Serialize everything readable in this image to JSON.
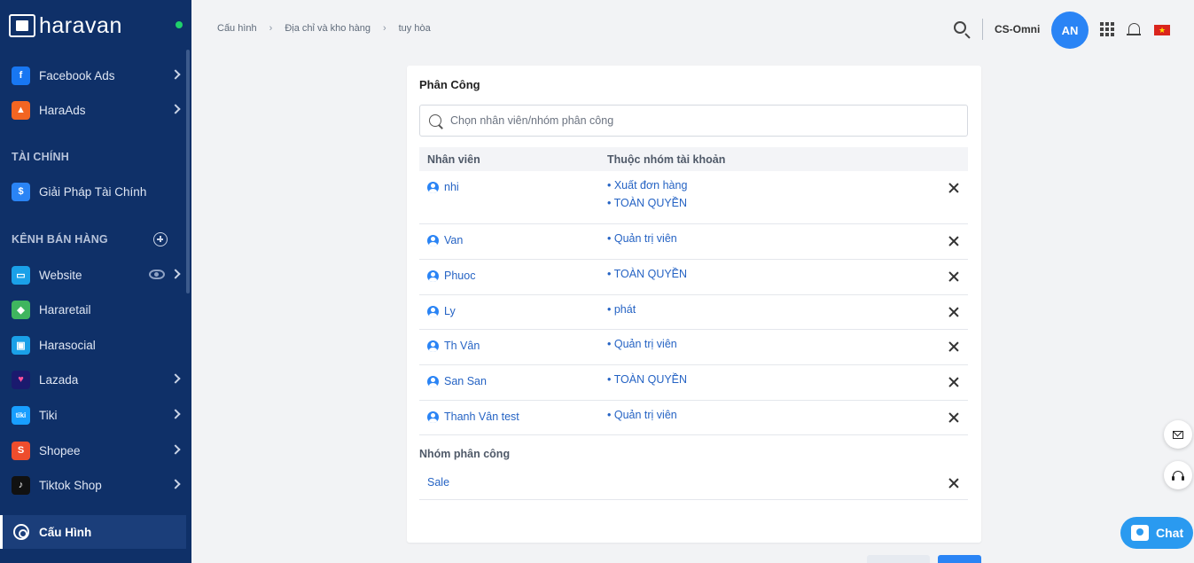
{
  "brand": {
    "logo_text": "haravan"
  },
  "sidebar": {
    "items_top": [
      {
        "label": "Facebook Ads",
        "icon": "facebook-icon",
        "color": "#1877f2",
        "glyph": "f"
      },
      {
        "label": "HaraAds",
        "icon": "haraads-icon",
        "color": "#f26522",
        "glyph": "▲"
      }
    ],
    "section_finance": "TÀI CHÍNH",
    "finance_item": {
      "label": "Giải Pháp Tài Chính",
      "icon": "finance-icon",
      "color": "#2a84f5",
      "glyph": "$"
    },
    "section_channels": "KÊNH BÁN HÀNG",
    "channels": [
      {
        "label": "Website",
        "icon": "website-icon",
        "color": "#1aa0e8",
        "glyph": "▭"
      },
      {
        "label": "Hararetail",
        "icon": "hararetail-icon",
        "color": "#3fb55f",
        "glyph": "◆"
      },
      {
        "label": "Harasocial",
        "icon": "harasocial-icon",
        "color": "#1aa0e8",
        "glyph": "▣"
      },
      {
        "label": "Lazada",
        "icon": "lazada-icon",
        "color": "#1a1a6e",
        "glyph": "♥"
      },
      {
        "label": "Tiki",
        "icon": "tiki-icon",
        "color": "#189eff",
        "glyph": "tiki"
      },
      {
        "label": "Shopee",
        "icon": "shopee-icon",
        "color": "#ee4d2d",
        "glyph": "S"
      },
      {
        "label": "Tiktok Shop",
        "icon": "tiktok-icon",
        "color": "#111111",
        "glyph": "♪"
      }
    ],
    "active_item": "Cấu Hình"
  },
  "breadcrumb": [
    "Cấu hình",
    "Địa chỉ và kho hàng",
    "tuy hòa"
  ],
  "header": {
    "store_name": "CS-Omni",
    "avatar_initials": "AN"
  },
  "card": {
    "title": "Phân Công",
    "search_placeholder": "Chọn nhân viên/nhóm phân công",
    "col_employee": "Nhân viên",
    "col_group": "Thuộc nhóm tài khoản",
    "rows": [
      {
        "name": "nhi",
        "groups": [
          "• Xuất đơn hàng",
          "• TOÀN QUYỀN"
        ]
      },
      {
        "name": "Van",
        "groups": [
          "• Quản trị viên"
        ]
      },
      {
        "name": "Phuoc",
        "groups": [
          "• TOÀN QUYỀN"
        ]
      },
      {
        "name": "Ly",
        "groups": [
          "• phát"
        ]
      },
      {
        "name": "Th Vân",
        "groups": [
          "• Quản trị viên"
        ]
      },
      {
        "name": "San San",
        "groups": [
          "• TOÀN QUYỀN"
        ]
      },
      {
        "name": "Thanh Vân test",
        "groups": [
          "• Quản trị viên"
        ]
      }
    ],
    "group_section_title": "Nhóm phân công",
    "assigned_groups": [
      "Sale"
    ]
  },
  "chat": {
    "label": "Chat"
  },
  "colors": {
    "sidebar": "#0f3068",
    "accent": "#2a84f5",
    "link": "#2563c4"
  }
}
